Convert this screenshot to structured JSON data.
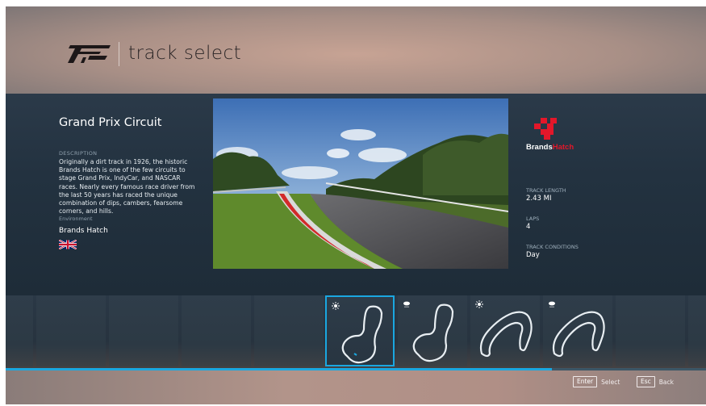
{
  "header": {
    "title": "track select",
    "logo_icon": "forza-motorsport-logo-icon"
  },
  "track": {
    "name": "Grand Prix Circuit",
    "description_label": "DESCRIPTION",
    "description": "Originally a dirt track in 1926, the historic Brands Hatch is one of the few circuits to stage Grand Prix, IndyCar, and NASCAR races. Nearly every famous race driver from the last 50 years has raced the unique combination of dips, cambers, fearsome corners, and hills.",
    "environment_label": "Environment",
    "environment_value": "Brands Hatch",
    "flag_icon": "uk-flag-icon"
  },
  "brand": {
    "name_part1": "Brands",
    "name_part2": "Hatch",
    "color_white": "#ffffff",
    "color_red": "#e3172a"
  },
  "stats": [
    {
      "label": "TRACK LENGTH",
      "value": "2.43 MI"
    },
    {
      "label": "LAPS",
      "value": "4"
    },
    {
      "label": "TRACK CONDITIONS",
      "value": "Day"
    }
  ],
  "carousel": {
    "tiles": [
      {
        "weather": "",
        "layout": "empty"
      },
      {
        "weather": "",
        "layout": "empty"
      },
      {
        "weather": "",
        "layout": "empty"
      },
      {
        "weather": "",
        "layout": "empty"
      },
      {
        "weather": "",
        "layout": "empty"
      },
      {
        "weather": "sun-icon",
        "layout": "gp",
        "selected": true
      },
      {
        "weather": "rain-cloud-icon",
        "layout": "gp"
      },
      {
        "weather": "sun-icon",
        "layout": "indy"
      },
      {
        "weather": "rain-cloud-icon",
        "layout": "indy"
      },
      {
        "weather": "",
        "layout": "empty"
      },
      {
        "weather": "",
        "layout": "empty"
      }
    ]
  },
  "progress": 0.78,
  "footer": {
    "select_key": "Enter",
    "select_label": "Select",
    "back_key": "Esc",
    "back_label": "Back"
  },
  "colors": {
    "accent": "#1aa7e0",
    "panel": "#233240"
  }
}
